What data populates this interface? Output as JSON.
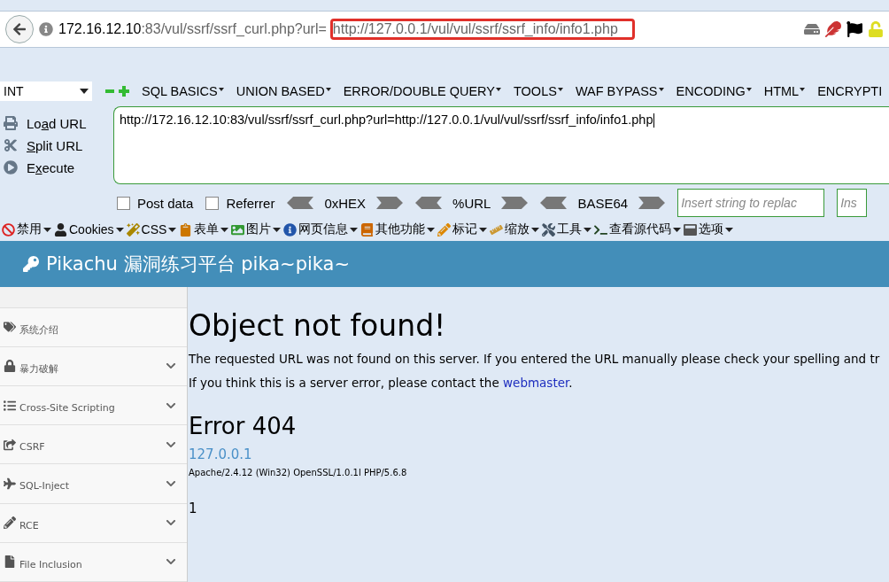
{
  "address_bar": {
    "host": "172.16.12.10",
    "path": ":83/vul/ssrf/ssrf_curl.php?url=",
    "highlighted_part": "http://127.0.0.1/vul/vul/ssrf/ssrf_info/info1.php",
    "highlighted": true
  },
  "hackbar": {
    "type_select": "INT",
    "menus": [
      "SQL BASICS",
      "UNION BASED",
      "ERROR/DOUBLE QUERY",
      "TOOLS",
      "WAF BYPASS",
      "ENCODING",
      "HTML",
      "ENCRYPTI"
    ],
    "actions": [
      {
        "before": "Lo",
        "key": "a",
        "after": "d URL"
      },
      {
        "key": "S",
        "after": "plit URL"
      },
      {
        "before": "E",
        "key": "x",
        "after": "ecute"
      }
    ],
    "url_value": "http://172.16.12.10:83/vul/ssrf/ssrf_curl.php?url=http://127.0.0.1/vul/vul/ssrf/ssrf_info/info1.php",
    "checkboxes": [
      {
        "label": "Post data",
        "checked": false
      },
      {
        "label": "Referrer",
        "checked": false
      }
    ],
    "encoders": [
      "0xHEX",
      "%URL",
      "BASE64"
    ],
    "replace_fields": [
      {
        "placeholder": "Insert string to replac"
      },
      {
        "placeholder": "Ins"
      }
    ]
  },
  "toolbar": [
    "禁用",
    "Cookies",
    "CSS",
    "表单",
    "图片",
    "网页信息",
    "其他功能",
    "标记",
    "缩放",
    "工具",
    "查看源代码",
    "选项"
  ],
  "site_header": {
    "title": "Pikachu 漏洞练习平台 pika~pika~"
  },
  "sidebar": {
    "items": [
      {
        "label": "系统介绍",
        "expandable": false
      },
      {
        "label": "暴力破解",
        "expandable": true
      },
      {
        "label": "Cross-Site Scripting",
        "expandable": true
      },
      {
        "label": "CSRF",
        "expandable": true
      },
      {
        "label": "SQL-Inject",
        "expandable": true
      },
      {
        "label": "RCE",
        "expandable": true
      },
      {
        "label": "File Inclusion",
        "expandable": true
      }
    ]
  },
  "content": {
    "heading": "Object not found!",
    "message": "The requested URL was not found on this server. If you entered the URL manually please check your spelling and tr",
    "contact_before": "If you think this is a server error, please contact the ",
    "contact_link": "webmaster",
    "contact_after": ".",
    "error_heading": "Error 404",
    "host_link": "127.0.0.1",
    "server_signature": "Apache/2.4.12 (Win32) OpenSSL/1.0.1l PHP/5.6.8",
    "output": "1"
  }
}
